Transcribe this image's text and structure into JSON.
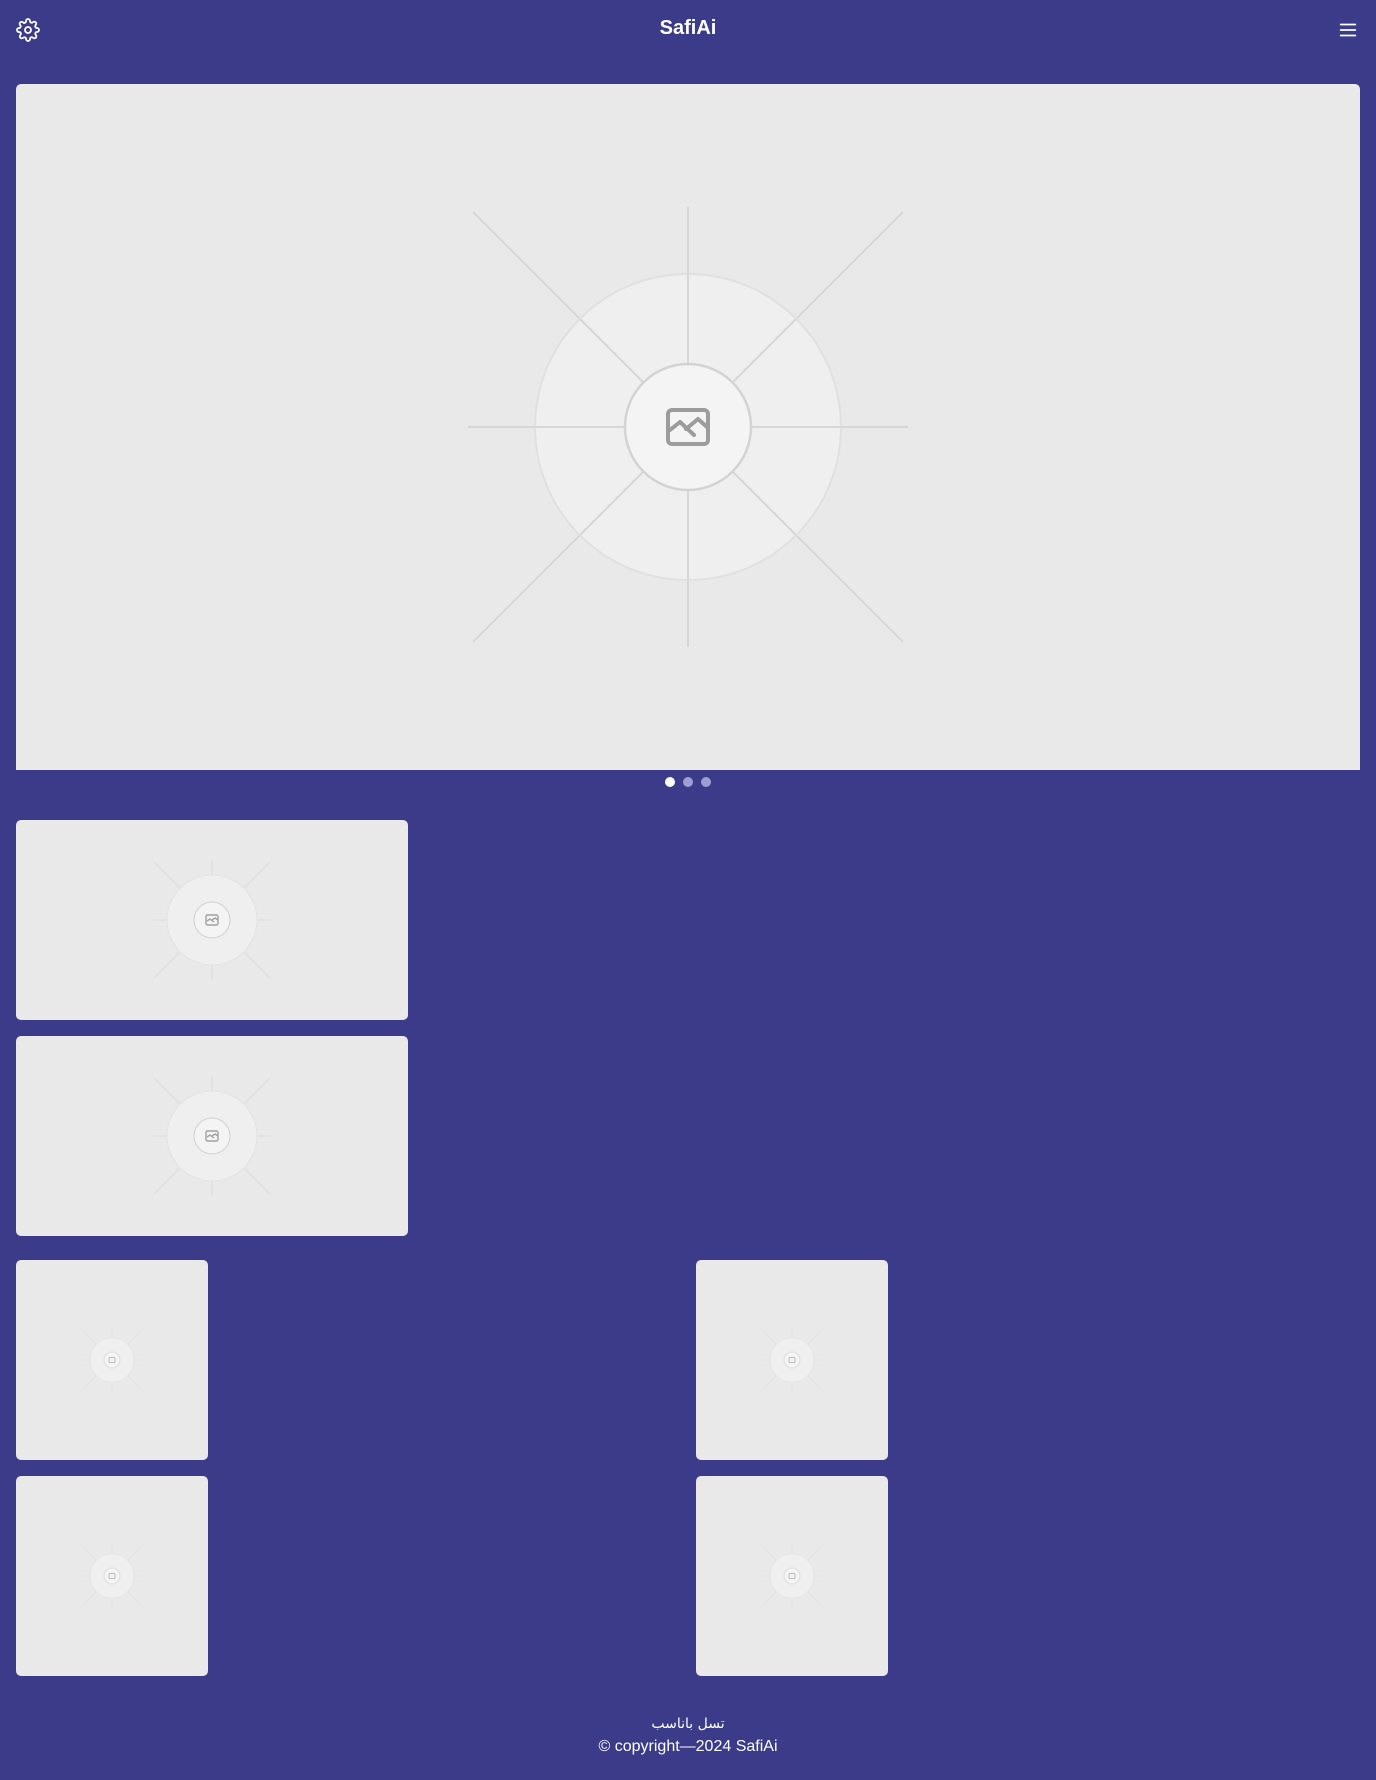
{
  "header": {
    "title": "SafiAi",
    "settings_icon": "gear-icon",
    "menu_icon": "hamburger-menu-icon"
  },
  "carousel": {
    "slide_count": 3,
    "active_index": 0,
    "placeholder_icon": "image-icon"
  },
  "cards": {
    "wide_count": 2,
    "square_count": 4,
    "placeholder_icon": "image-icon"
  },
  "footer": {
    "arabic_link": "تسل باناسب",
    "copyright": "© copyright—2024 SafiAi"
  },
  "colors": {
    "background": "#3b3b8a",
    "placeholder": "#e9e9e9",
    "dot_active": "#ffffff",
    "dot_inactive": "#9e9ed4"
  }
}
